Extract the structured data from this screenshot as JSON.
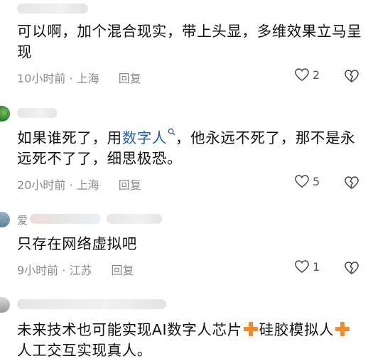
{
  "comments": [
    {
      "username": "",
      "text_lines": [
        "可以啊，加个混合现实，带上头显，多维效果立马呈",
        "现"
      ],
      "time_location": "10小时前 · 上海",
      "reply_label": "回复",
      "likes": "2"
    },
    {
      "username": "",
      "text_part1": "如果谁死了，用",
      "keyword": "数字人",
      "text_part2": "，他永远不死了，那不是永",
      "text_line2": "远死不了了，细思极恐。",
      "time_location": "20小时前 · 上海",
      "reply_label": "回复",
      "likes": "5"
    },
    {
      "username": "爱",
      "text_lines": [
        "只存在网络虚拟吧"
      ],
      "time_location": "9小时前 · 江苏",
      "reply_label": "回复",
      "likes": "1"
    },
    {
      "username": "",
      "text_part1": "未来技术也可能实现AI数字人芯片",
      "text_part2": "硅胶模拟人",
      "text_line2": "人工交互实现真人。",
      "time_location": "",
      "reply_label": "",
      "likes": ""
    }
  ],
  "colors": {
    "accent_link": "#1f5fa8",
    "plus": "#f08a2c",
    "meta": "#8a8a8a"
  },
  "icons": [
    "heart-outline-icon",
    "broken-heart-icon",
    "search-icon",
    "plus-icon"
  ]
}
